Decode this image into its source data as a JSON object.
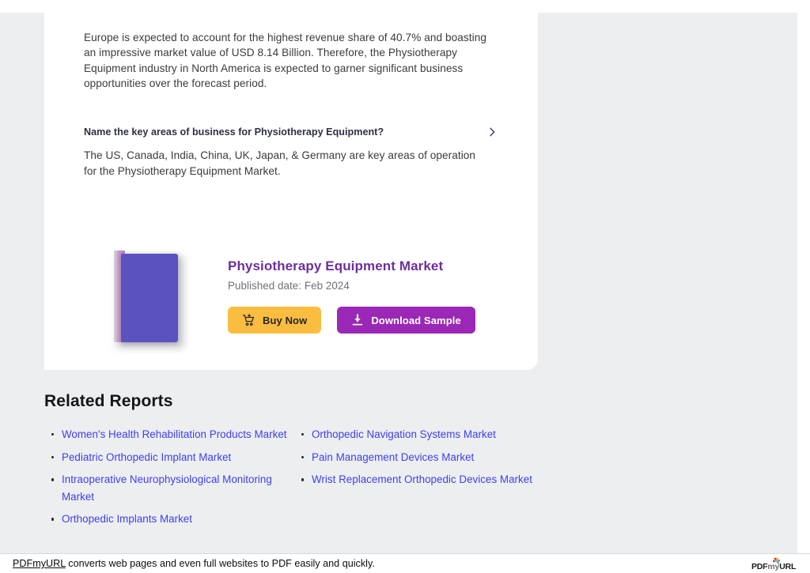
{
  "document": {
    "intro_paragraph": "Europe is expected to account for the highest revenue share of 40.7% and boasting an impressive market value of USD 8.14 Billion. Therefore, the Physiotherapy Equipment industry in North America is expected to garner significant business opportunities over the forecast period."
  },
  "faq": {
    "question": "Name the key areas of business for Physiotherapy Equipment?",
    "answer": "The US, Canada, India, China, UK, Japan, & Germany are key areas of operation for the Physiotherapy Equipment Market.",
    "expand_icon": "chevron-right-icon"
  },
  "report_promo": {
    "cover_alt": "report-cover-image",
    "title": "Physiotherapy Equipment Market",
    "published_date": "Published date: Feb 2024",
    "buy_button": {
      "label": "Buy Now",
      "icon": "shopping-cart-plus-icon",
      "bg_color": "#fbbd40",
      "text_color": "#26262b"
    },
    "download_button": {
      "label": "Download Sample",
      "icon": "download-icon",
      "bg_color": "#9a27b5",
      "text_color": "#ffffff"
    },
    "title_color": "#6c2f9e"
  },
  "related_reports": {
    "heading": "Related Reports",
    "link_color": "#3f3ff0",
    "left_column": [
      "Women's Health Rehabilitation Products Market",
      "Pediatric Orthopedic Implant Market",
      "Intraoperative Neurophysiological Monitoring Market",
      "Orthopedic Implants Market"
    ],
    "right_column": [
      "Orthopedic Navigation Systems Market",
      "Pain Management Devices Market",
      "Wrist Replacement Orthopedic Devices Market"
    ]
  },
  "footer": {
    "link_label": "PDFmyURL",
    "message": " converts web pages and even full websites to PDF easily and quickly.",
    "logo_pdf": "PDF",
    "logo_my": "my",
    "logo_url": "URL",
    "logo_icon": "pinwheel-icon"
  }
}
